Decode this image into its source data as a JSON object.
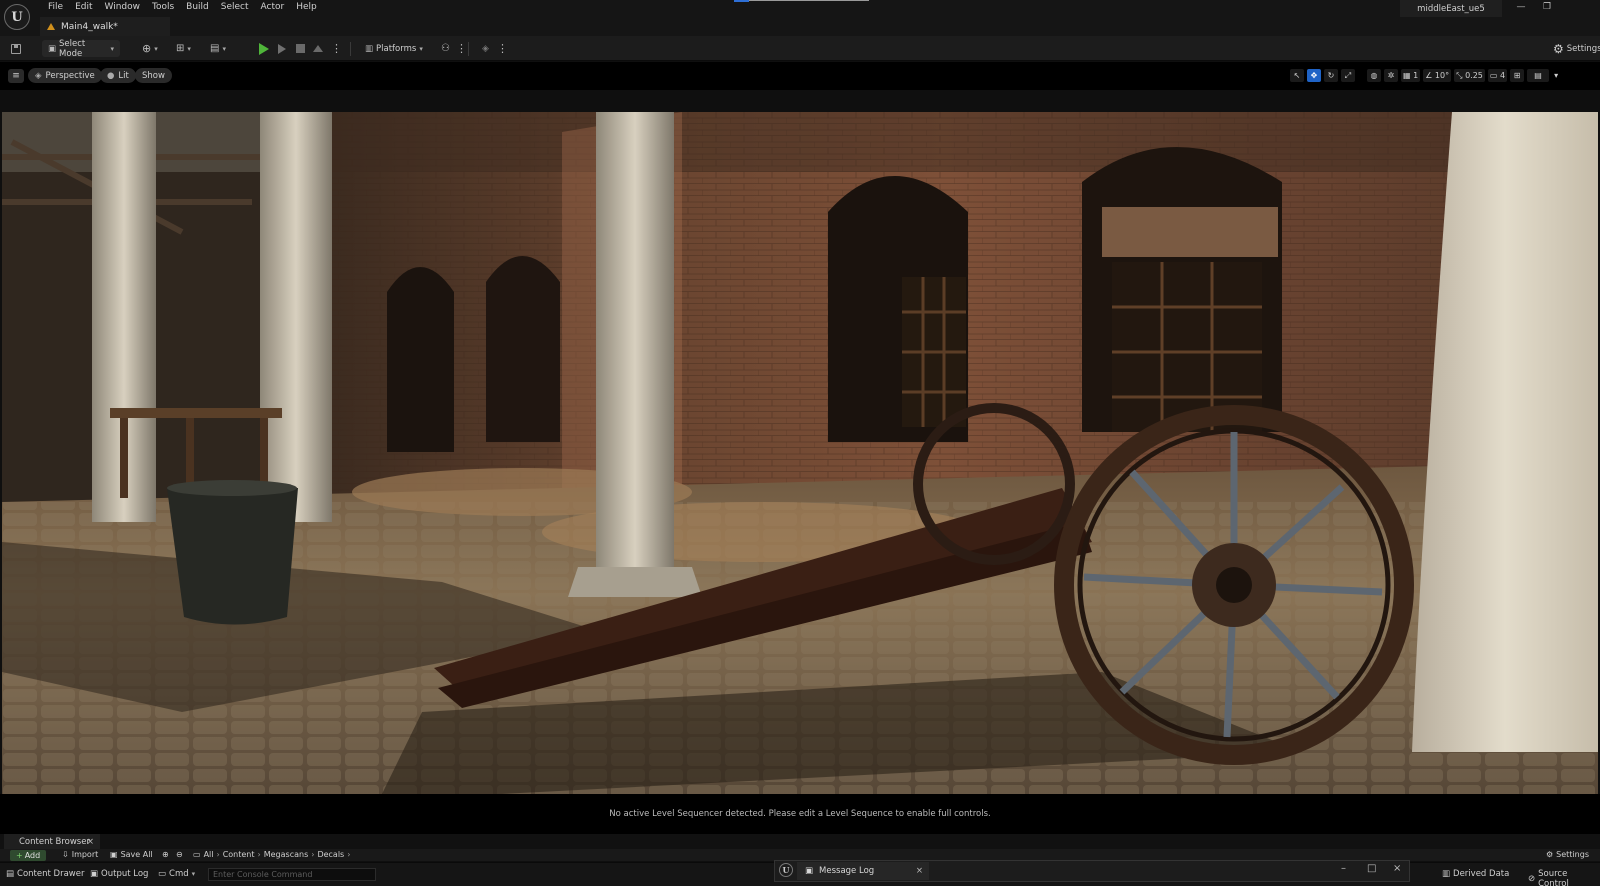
{
  "app": {
    "logo": "U",
    "project_name": "middleEast_ue5"
  },
  "menu": [
    "File",
    "Edit",
    "Window",
    "Tools",
    "Build",
    "Select",
    "Actor",
    "Help"
  ],
  "window_controls": {
    "minimize": "—",
    "maximize": "❐"
  },
  "level_tab": {
    "label": "Main4_walk*"
  },
  "toolbar": {
    "select_mode": "Select Mode",
    "platforms": "Platforms",
    "settings": "Settings"
  },
  "viewport": {
    "perspective": "Perspective",
    "lit": "Lit",
    "show": "Show",
    "grid_snap": "1",
    "rotation_snap": "10°",
    "scale_snap": "0.25",
    "camera_speed": "4"
  },
  "sequencer": {
    "message": "No active Level Sequencer detected. Please edit a Level Sequence to enable full controls."
  },
  "content_browser": {
    "tab": "Content Browser",
    "add": "Add",
    "import": "Import",
    "save_all": "Save All",
    "breadcrumb": [
      "All",
      "Content",
      "Megascans",
      "Decals"
    ],
    "settings": "Settings"
  },
  "statusbar": {
    "content_drawer": "Content Drawer",
    "output_log": "Output Log",
    "cmd": "Cmd",
    "console_placeholder": "Enter Console Command",
    "derived_data": "Derived Data",
    "source_control": "Source Control"
  },
  "message_log": {
    "label": "Message Log"
  },
  "colors": {
    "accent": "#1f63c6",
    "play": "#4fb53a",
    "level_icon": "#d1901c"
  }
}
